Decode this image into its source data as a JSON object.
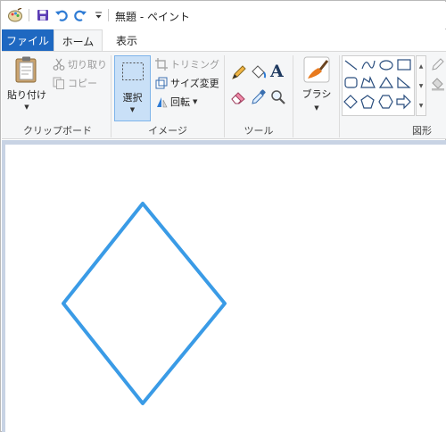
{
  "window": {
    "title": "無題 - ペイント"
  },
  "quick_access": {
    "icons": [
      "paint-app-icon",
      "save-icon",
      "undo-icon",
      "redo-icon",
      "customize-dropdown-icon"
    ]
  },
  "tabs": {
    "file": "ファイル",
    "home": "ホーム",
    "view": "表示"
  },
  "ribbon": {
    "clipboard": {
      "paste": "貼り付け",
      "cut": "切り取り",
      "copy": "コピー",
      "label": "クリップボード"
    },
    "image": {
      "select": "選択",
      "crop": "トリミング",
      "resize": "サイズ変更",
      "rotate": "回転",
      "label": "イメージ"
    },
    "tools": {
      "label": "ツール",
      "text_tool_glyph": "A"
    },
    "brushes": {
      "label": "ブラシ"
    },
    "shapes": {
      "label": "図形"
    }
  },
  "canvas": {
    "shape": "diamond",
    "stroke_color": "#3a9be6"
  },
  "colors": {
    "file_tab": "#1e68c1",
    "ribbon_bg": "#f5f6f7",
    "workspace_bg": "#c8d3e4",
    "selected_button": "#c9e0f7",
    "shape_stroke": "#3a9be6"
  }
}
